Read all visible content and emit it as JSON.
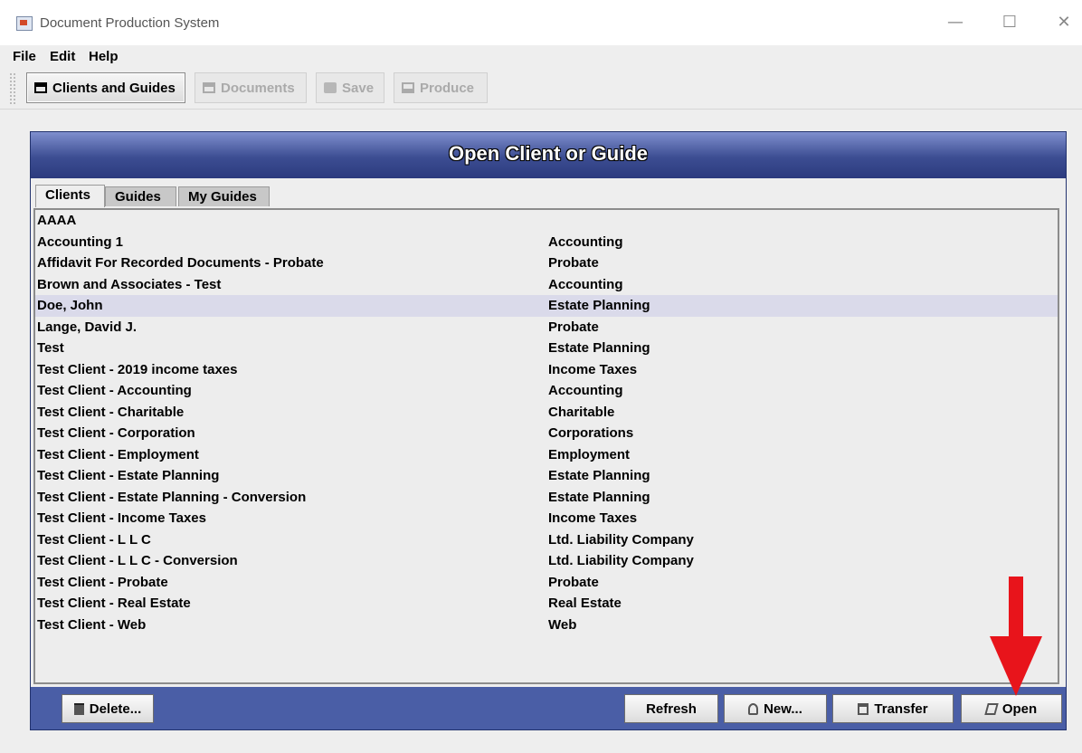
{
  "window": {
    "title": "Document Production System",
    "controls": [
      "—",
      "☐",
      "✕"
    ]
  },
  "menubar": {
    "items": [
      "File",
      "Edit",
      "Help"
    ]
  },
  "toolbar": {
    "buttons": [
      {
        "label": "Clients and Guides",
        "icon": "cabinet-icon",
        "enabled": true
      },
      {
        "label": "Documents",
        "icon": "documents-icon",
        "enabled": false
      },
      {
        "label": "Save",
        "icon": "save-icon",
        "enabled": false
      },
      {
        "label": "Produce",
        "icon": "printer-icon",
        "enabled": false
      }
    ]
  },
  "dialog": {
    "title": "Open Client or Guide",
    "tabs": [
      {
        "label": "Clients",
        "selected": true
      },
      {
        "label": "Guides",
        "selected": false
      },
      {
        "label": "My Guides",
        "selected": false
      }
    ],
    "rows": [
      {
        "name": "AAAA",
        "type": ""
      },
      {
        "name": "Accounting 1",
        "type": "Accounting"
      },
      {
        "name": "Affidavit For Recorded Documents - Probate",
        "type": "Probate"
      },
      {
        "name": "Brown and Associates - Test",
        "type": "Accounting"
      },
      {
        "name": "Doe, John",
        "type": "Estate Planning",
        "selected": true
      },
      {
        "name": "Lange, David J.",
        "type": "Probate"
      },
      {
        "name": "Test",
        "type": "Estate Planning"
      },
      {
        "name": "Test Client - 2019 income taxes",
        "type": "Income Taxes"
      },
      {
        "name": "Test Client - Accounting",
        "type": "Accounting"
      },
      {
        "name": "Test Client - Charitable",
        "type": "Charitable"
      },
      {
        "name": "Test Client - Corporation",
        "type": "Corporations"
      },
      {
        "name": "Test Client - Employment",
        "type": "Employment"
      },
      {
        "name": "Test Client - Estate Planning",
        "type": "Estate Planning"
      },
      {
        "name": "Test Client - Estate Planning - Conversion",
        "type": "Estate Planning"
      },
      {
        "name": "Test Client - Income Taxes",
        "type": "Income Taxes"
      },
      {
        "name": "Test Client - L L C",
        "type": "Ltd. Liability Company"
      },
      {
        "name": "Test Client - L L C - Conversion",
        "type": "Ltd. Liability Company"
      },
      {
        "name": "Test Client - Probate",
        "type": "Probate"
      },
      {
        "name": "Test Client - Real Estate",
        "type": "Real Estate"
      },
      {
        "name": "Test Client - Web",
        "type": "Web"
      }
    ],
    "buttons": {
      "delete": "Delete...",
      "refresh": "Refresh",
      "new": "New...",
      "transfer": "Transfer",
      "open": "Open"
    }
  },
  "colors": {
    "panel": "#4a5ea6",
    "selected_row": "#dadaea",
    "annotation_arrow": "#e8141b"
  }
}
